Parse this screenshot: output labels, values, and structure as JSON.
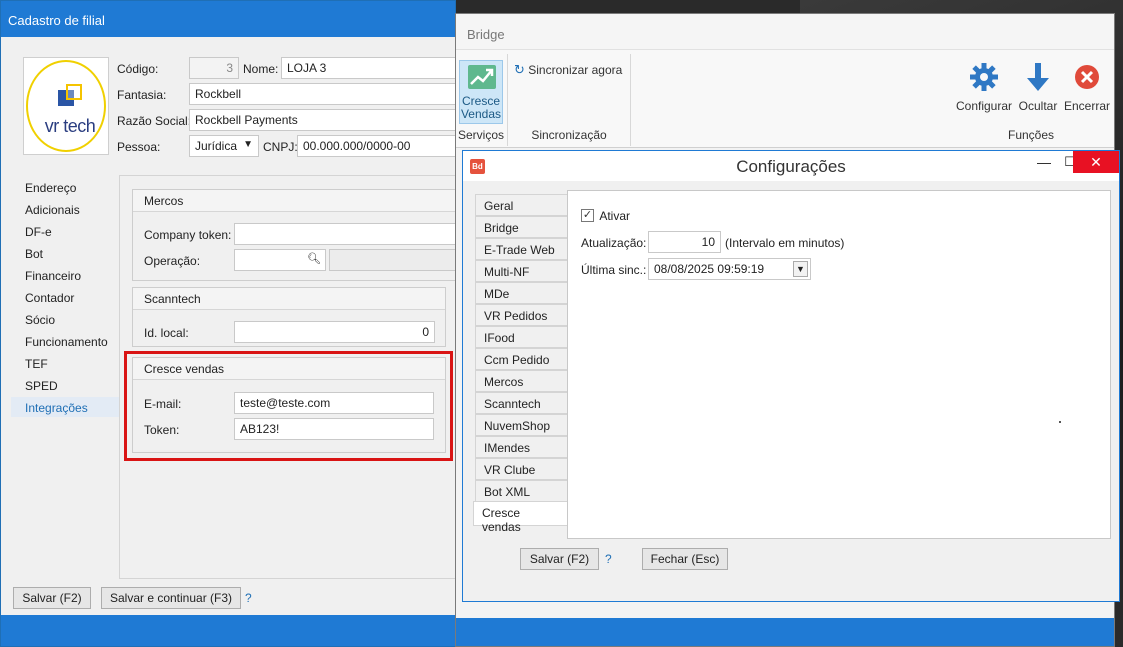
{
  "filial": {
    "title": "Cadastro de filial",
    "logo_text": "vr tech",
    "codigo_label": "Código:",
    "codigo_value": "3",
    "nome_label": "Nome:",
    "nome_value": "LOJA 3",
    "fantasia_label": "Fantasia:",
    "fantasia_value": "Rockbell",
    "razao_label": "Razão Social:",
    "razao_value": "Rockbell Payments",
    "pessoa_label": "Pessoa:",
    "pessoa_value": "Jurídica",
    "cnpj_label": "CNPJ:",
    "cnpj_value": "00.000.000/0000-00",
    "nav": [
      "Endereço",
      "Adicionais",
      "DF-e",
      "Bot",
      "Financeiro",
      "Contador",
      "Sócio",
      "Funcionamento",
      "TEF",
      "SPED",
      "Integrações"
    ],
    "mercos": {
      "title": "Mercos",
      "company_token_label": "Company token:",
      "company_token_value": "",
      "operacao_label": "Operação:"
    },
    "scanntech": {
      "title": "Scanntech",
      "id_local_label": "Id. local:",
      "id_local_value": "0"
    },
    "cresce": {
      "title": "Cresce vendas",
      "email_label": "E-mail:",
      "email_value": "teste@teste.com",
      "token_label": "Token:",
      "token_value": "AB123!"
    },
    "buttons": {
      "save": "Salvar (F2)",
      "save_continue": "Salvar e continuar (F3)",
      "help": "?"
    }
  },
  "bridge": {
    "title": "Bridge",
    "cresce_btn": "Cresce Vendas",
    "sync_now": "Sincronizar agora",
    "group_servicos": "Serviços",
    "group_sinc": "Sincronização",
    "group_funcoes": "Funções",
    "configurar": "Configurar",
    "ocultar": "Ocultar",
    "encerrar": "Encerrar"
  },
  "config": {
    "title": "Configurações",
    "icon_text": "Bd",
    "tabs": [
      "Geral",
      "Bridge",
      "E-Trade Web",
      "Multi-NF",
      "MDe",
      "VR Pedidos",
      "IFood",
      "Ccm Pedido",
      "Mercos",
      "Scanntech",
      "NuvemShop",
      "IMendes",
      "VR Clube",
      "Bot XML",
      "Cresce vendas"
    ],
    "ativar_label": "Ativar",
    "ativar_checked": true,
    "atualizacao_label": "Atualização:",
    "atualizacao_value": "10",
    "intervalo_text": "(Intervalo em minutos)",
    "ultima_label": "Última sinc.:",
    "ultima_value": "08/08/2025 09:59:19",
    "salvar": "Salvar (F2)",
    "help": "?",
    "fechar": "Fechar (Esc)"
  },
  "colors": {
    "accent": "#1f7ad4",
    "highlight_border": "#d91414",
    "close_red": "#e81123"
  }
}
